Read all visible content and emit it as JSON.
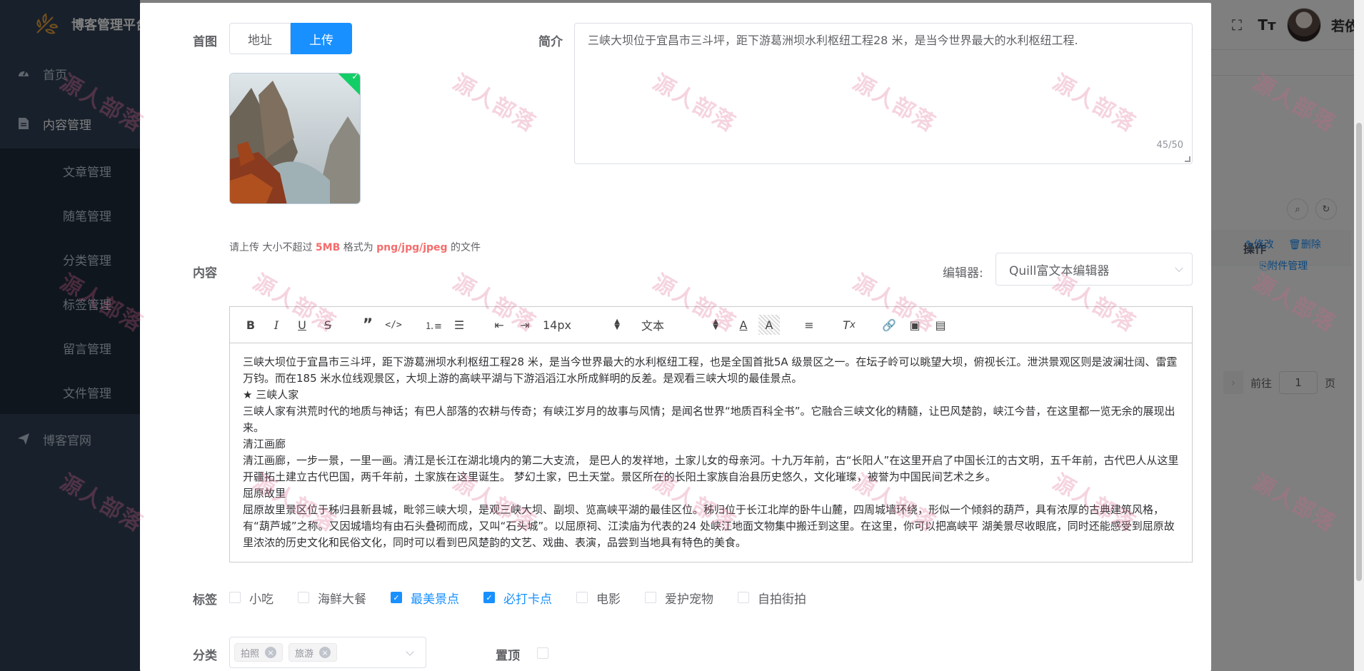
{
  "app": {
    "brand": "博客管理平台"
  },
  "sidebar": {
    "items": [
      {
        "label": "首页",
        "icon": "dashboard-icon"
      },
      {
        "label": "内容管理",
        "icon": "document-icon"
      },
      {
        "label": "博客官网",
        "icon": "send-icon"
      }
    ],
    "submenu": [
      {
        "label": "文章管理"
      },
      {
        "label": "随笔管理"
      },
      {
        "label": "分类管理"
      },
      {
        "label": "标签管理"
      },
      {
        "label": "留言管理"
      },
      {
        "label": "文件管理"
      }
    ]
  },
  "topbar": {
    "username": "若依"
  },
  "background_table": {
    "op_header": "操作",
    "edit": "修改",
    "delete": "删除",
    "attachment": "附件管理",
    "goto_label": "前往",
    "page_value": "1",
    "page_suffix": "页"
  },
  "form": {
    "cover": {
      "label": "首图",
      "options": [
        "地址",
        "上传"
      ],
      "selected": "上传",
      "tip_prefix": "请上传 大小不超过 ",
      "tip_size": "5MB",
      "tip_mid": " 格式为 ",
      "tip_formats": "png/jpg/jpeg",
      "tip_suffix": " 的文件"
    },
    "summary": {
      "label": "简介",
      "value": "三峡大坝位于宜昌市三斗坪，距下游葛洲坝水利枢纽工程28 米，是当今世界最大的水利枢纽工程.",
      "count": "45/50"
    },
    "content": {
      "label": "内容",
      "editor_label": "编辑器:",
      "editor_value": "Quill富文本编辑器",
      "font_size": "14px",
      "text_style": "文本",
      "paragraphs": [
        "三峡大坝位于宜昌市三斗坪，距下游葛洲坝水利枢纽工程28 米，是当今世界最大的水利枢纽工程，也是全国首批5A 级景区之一。在坛子岭可以眺望大坝，俯视长江。泄洪景观区则是波澜壮阔、雷霆万钧。而在185 米水位线观景区，大坝上游的高峡平湖与下游滔滔江水所成鲜明的反差。是观看三峡大坝的最佳景点。",
        "★ 三峡人家",
        "三峡人家有洪荒时代的地质与神话；有巴人部落的农耕与传奇；有峡江岁月的故事与风情；是闻名世界“地质百科全书”。它融合三峡文化的精髓，让巴风楚韵，峡江今昔，在这里都一览无余的展现出来。",
        " 清江画廊",
        "清江画廊，一步一景，一里一画。清江是长江在湖北境内的第二大支流， 是巴人的发祥地，土家儿女的母亲河。十九万年前，古“长阳人”在这里开启了中国长江的古文明，五千年前，古代巴人从这里开疆拓土建立古代巴国，两千年前，土家族在这里诞生。 梦幻土家，巴土天堂。景区所在的长阳土家族自治县历史悠久，文化璀璨，被誉为中国民间艺术之乡。",
        " 屈原故里",
        "屈原故里景区位于秭归县新县城，毗邻三峡大坝，是观三峡大坝、副坝、览高峡平湖的最佳区位。秭归位于长江北岸的卧牛山麓，四周城墙环绕，形似一个倾斜的葫芦，具有浓厚的古典建筑风格，有“葫芦城”之称。又因城墙均有由石头叠砌而成，又叫“石头城”。以屈原祠、江渎庙为代表的24 处峡江地面文物集中搬迁到这里。在这里，你可以把高峡平 湖美景尽收眼底，同时还能感受到屈原故里浓浓的历史文化和民俗文化，同时可以看到巴风楚韵的文艺、戏曲、表演，品尝到当地具有特色的美食。"
      ]
    },
    "tags": {
      "label": "标签",
      "options": [
        {
          "label": "小吃",
          "checked": false
        },
        {
          "label": "海鲜大餐",
          "checked": false
        },
        {
          "label": "最美景点",
          "checked": true
        },
        {
          "label": "必打卡点",
          "checked": true
        },
        {
          "label": "电影",
          "checked": false
        },
        {
          "label": "爱护宠物",
          "checked": false
        },
        {
          "label": "自拍街拍",
          "checked": false
        }
      ]
    },
    "category": {
      "label": "分类",
      "selected": [
        "拍照",
        "旅游"
      ]
    },
    "pin": {
      "label": "置顶",
      "checked": false
    }
  },
  "watermark": {
    "text": "源人部落"
  },
  "colors": {
    "primary": "#1890ff",
    "danger": "#f56c6c",
    "sidebar": "#304156",
    "success": "#13ce66"
  }
}
